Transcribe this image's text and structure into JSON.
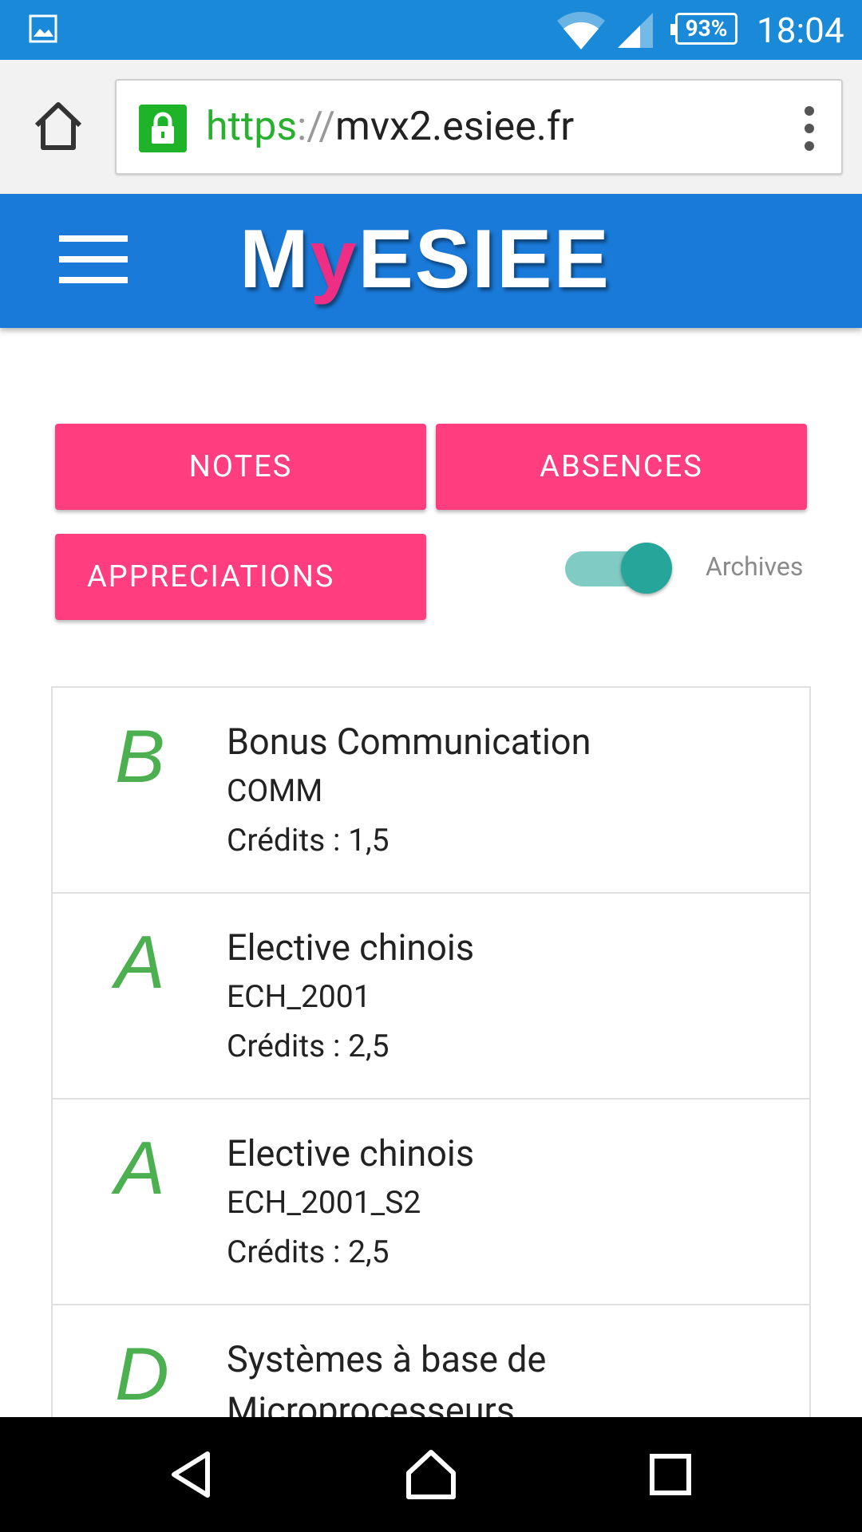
{
  "status_bar": {
    "battery": "93%",
    "time": "18:04"
  },
  "browser": {
    "url_scheme": "https",
    "url_separator": "://",
    "url_host": "mvx2.esiee.fr"
  },
  "app_header": {
    "logo_part1": "M",
    "logo_part2": "y",
    "logo_part3": "ESIEE"
  },
  "buttons": {
    "notes": "NOTES",
    "absences": "ABSENCES",
    "appreciations": "APPRECIATIONS"
  },
  "toggle": {
    "label": "Archives",
    "on": true
  },
  "courses": [
    {
      "grade": "B",
      "title": "Bonus Communication",
      "code": "COMM",
      "credits": "Crédits : 1,5"
    },
    {
      "grade": "A",
      "title": "Elective chinois",
      "code": "ECH_2001",
      "credits": "Crédits : 2,5"
    },
    {
      "grade": "A",
      "title": "Elective chinois",
      "code": "ECH_2001_S2",
      "credits": "Crédits : 2,5"
    },
    {
      "grade": "D",
      "title": "Systèmes à base de Microprocesseurs",
      "code": "",
      "credits": ""
    }
  ],
  "colors": {
    "status_bar": "#1a8ad8",
    "header": "#1a7ad9",
    "button": "#ff3d7f",
    "grade": "#4caf50",
    "toggle": "#26a69a",
    "logo_accent": "#ee2e85"
  }
}
